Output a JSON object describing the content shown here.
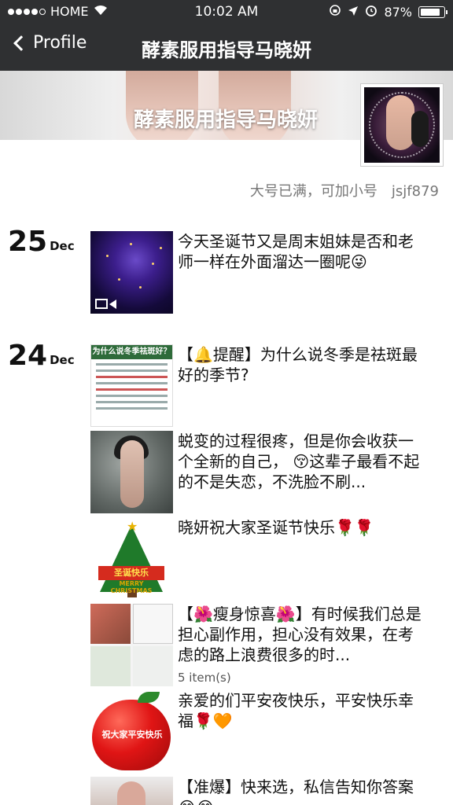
{
  "status_bar": {
    "carrier": "HOME",
    "time": "10:02 AM",
    "battery": "87%",
    "battery_level": 0.87
  },
  "nav": {
    "back_label": "Profile",
    "title": "酵素服用指导马晓妍"
  },
  "profile": {
    "cover_name": "酵素服用指导马晓妍",
    "signature": "大号已满，可加小号　jsjf879"
  },
  "feed": {
    "days": [
      {
        "day": "25",
        "month": "Dec",
        "posts": [
          {
            "text": "今天圣诞节又是周末姐妹是否和老师一样在外面溜达一圈呢😜",
            "media": "video"
          }
        ]
      },
      {
        "day": "24",
        "month": "Dec",
        "posts": [
          {
            "text": "【🔔提醒】为什么说冬季是祛斑最好的季节?",
            "thumb_title": "为什么说冬季祛斑好？"
          },
          {
            "text": "蜕变的过程很疼，但是你会收获一个全新的自己， 😚这辈子最看不起的不是失恋，不洗脸不刷..."
          },
          {
            "text": "晓妍祝大家圣诞节快乐🌹🌹",
            "thumb_banner": "圣诞快乐",
            "thumb_caption": "MERRY CHRISTMAS"
          },
          {
            "text": "【🌺瘦身惊喜🌺】有时候我们总是担心副作用，担心没有效果，在考虑的路上浪费很多的时...",
            "count": "5 item(s)"
          },
          {
            "text": "亲爱的们平安夜快乐，平安快乐幸福🌹🧡",
            "thumb_text": "祝大家平安快乐"
          },
          {
            "text": "【准爆】快来选，私信告知你答案😂😂"
          }
        ]
      }
    ]
  }
}
